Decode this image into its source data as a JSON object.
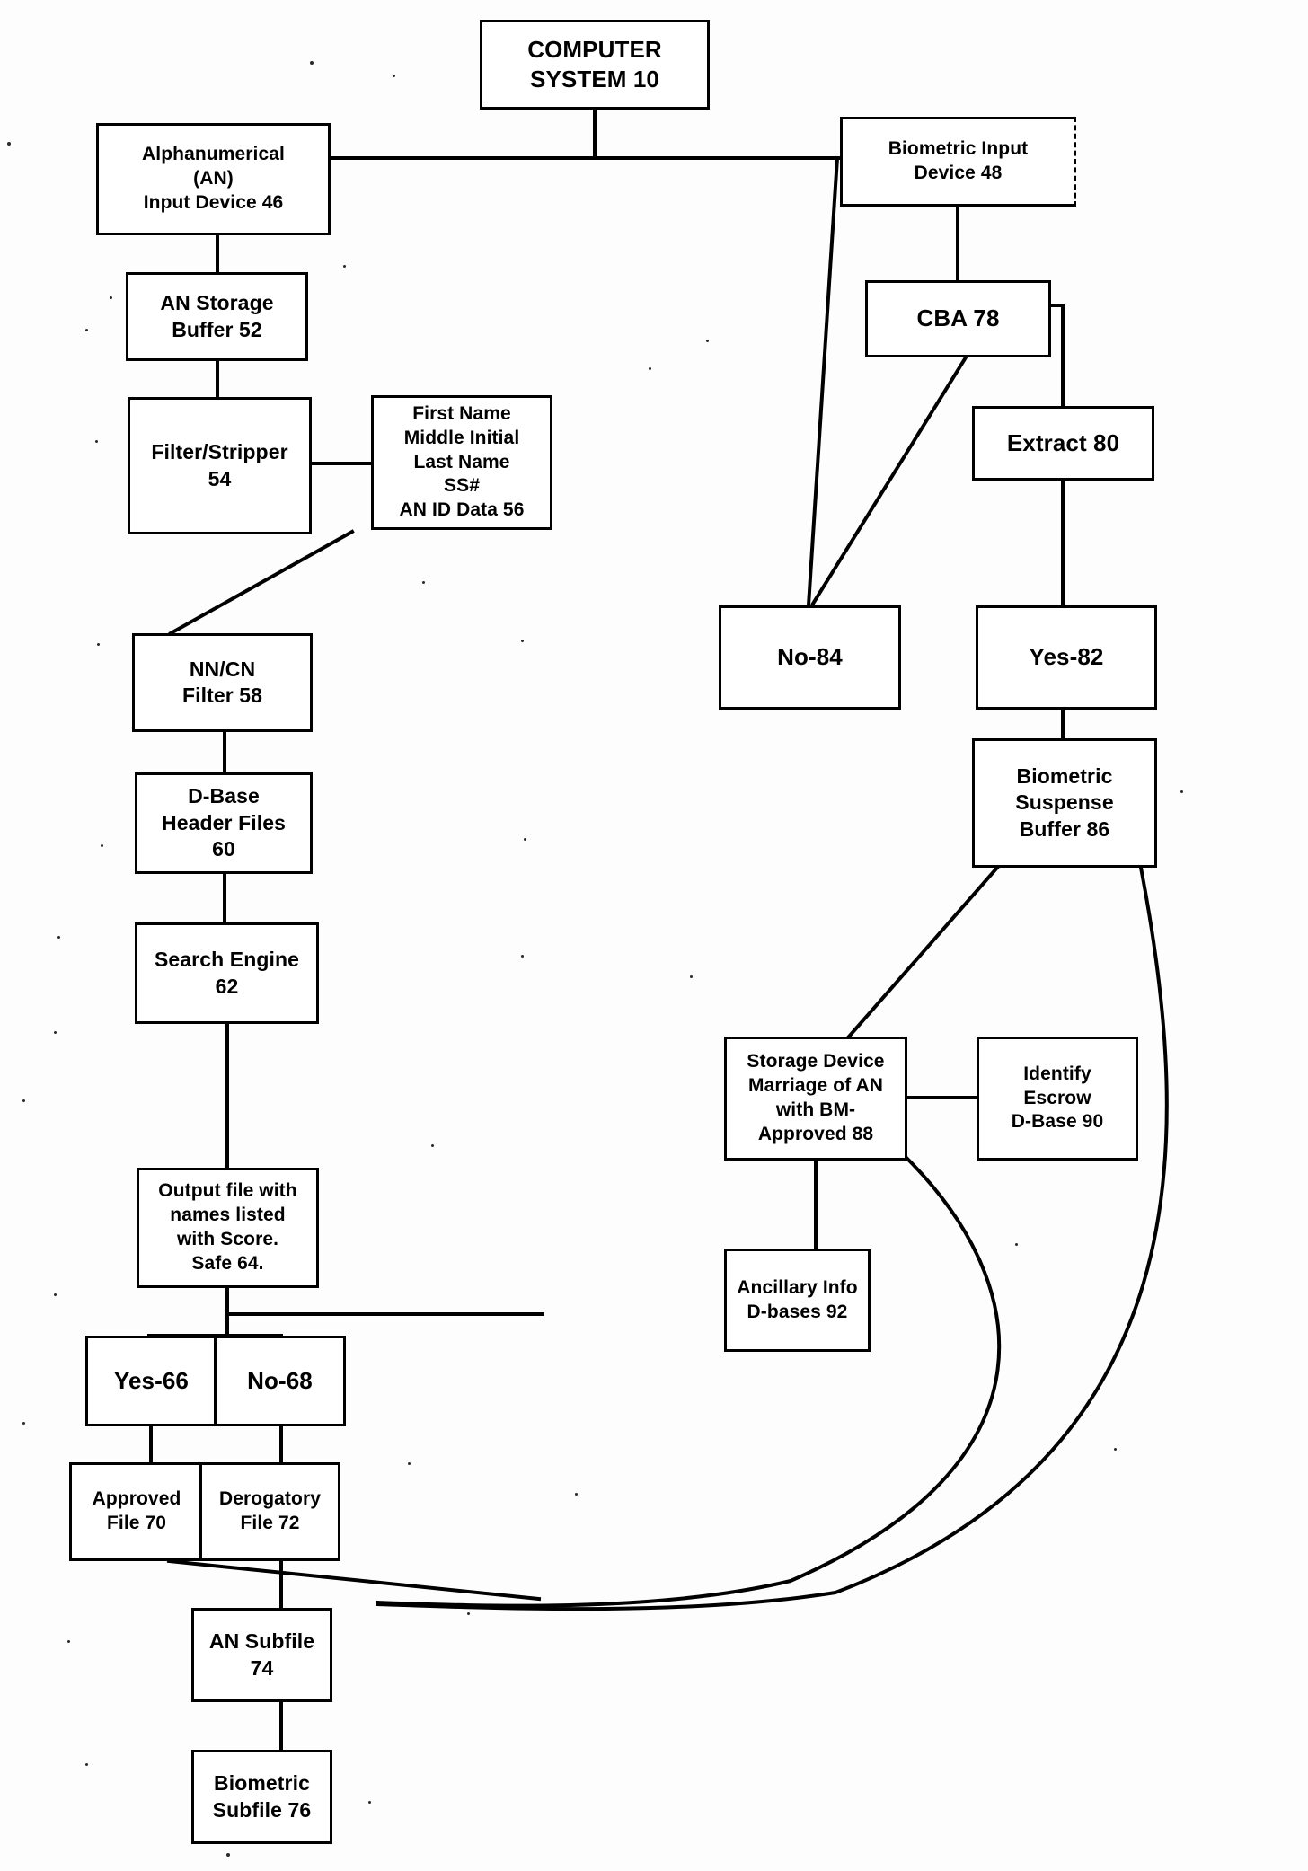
{
  "figure": {
    "type": "patent-flowchart",
    "title_block": "COMPUTER SYSTEM 10"
  },
  "nodes": {
    "computer_system": "COMPUTER\nSYSTEM 10",
    "an_input_device": "Alphanumerical\n(AN)\nInput Device 46",
    "an_storage_buffer": "AN Storage\nBuffer 52",
    "filter_stripper": "Filter/Stripper\n54",
    "an_id_data": "First Name\nMiddle Initial\nLast Name\nSS#\nAN ID Data 56",
    "nn_cn_filter": "NN/CN\nFilter 58",
    "dbase_header_files": "D-Base\nHeader Files\n60",
    "search_engine": "Search Engine\n62",
    "output_file": "Output file with\nnames listed\nwith Score.\nSafe 64.",
    "yes_66": "Yes-66",
    "no_68": "No-68",
    "approved_file": "Approved\nFile 70",
    "derogatory_file": "Derogatory\nFile 72",
    "an_subfile": "AN Subfile\n74",
    "biometric_subfile": "Biometric\nSubfile 76",
    "biometric_input_device": "Biometric Input\nDevice 48",
    "cba_78": "CBA 78",
    "extract_80": "Extract 80",
    "no_84": "No-84",
    "yes_82": "Yes-82",
    "biometric_suspense_buffer": "Biometric\nSuspense\nBuffer 86",
    "storage_device": "Storage Device\nMarriage of AN\nwith BM-\nApproved 88",
    "identify_escrow": "Identify\nEscrow\nD-Base 90",
    "ancillary_info": "Ancillary Info\nD-bases 92"
  },
  "colors": {
    "ink": "#000000",
    "paper": "#fdfdfd"
  }
}
